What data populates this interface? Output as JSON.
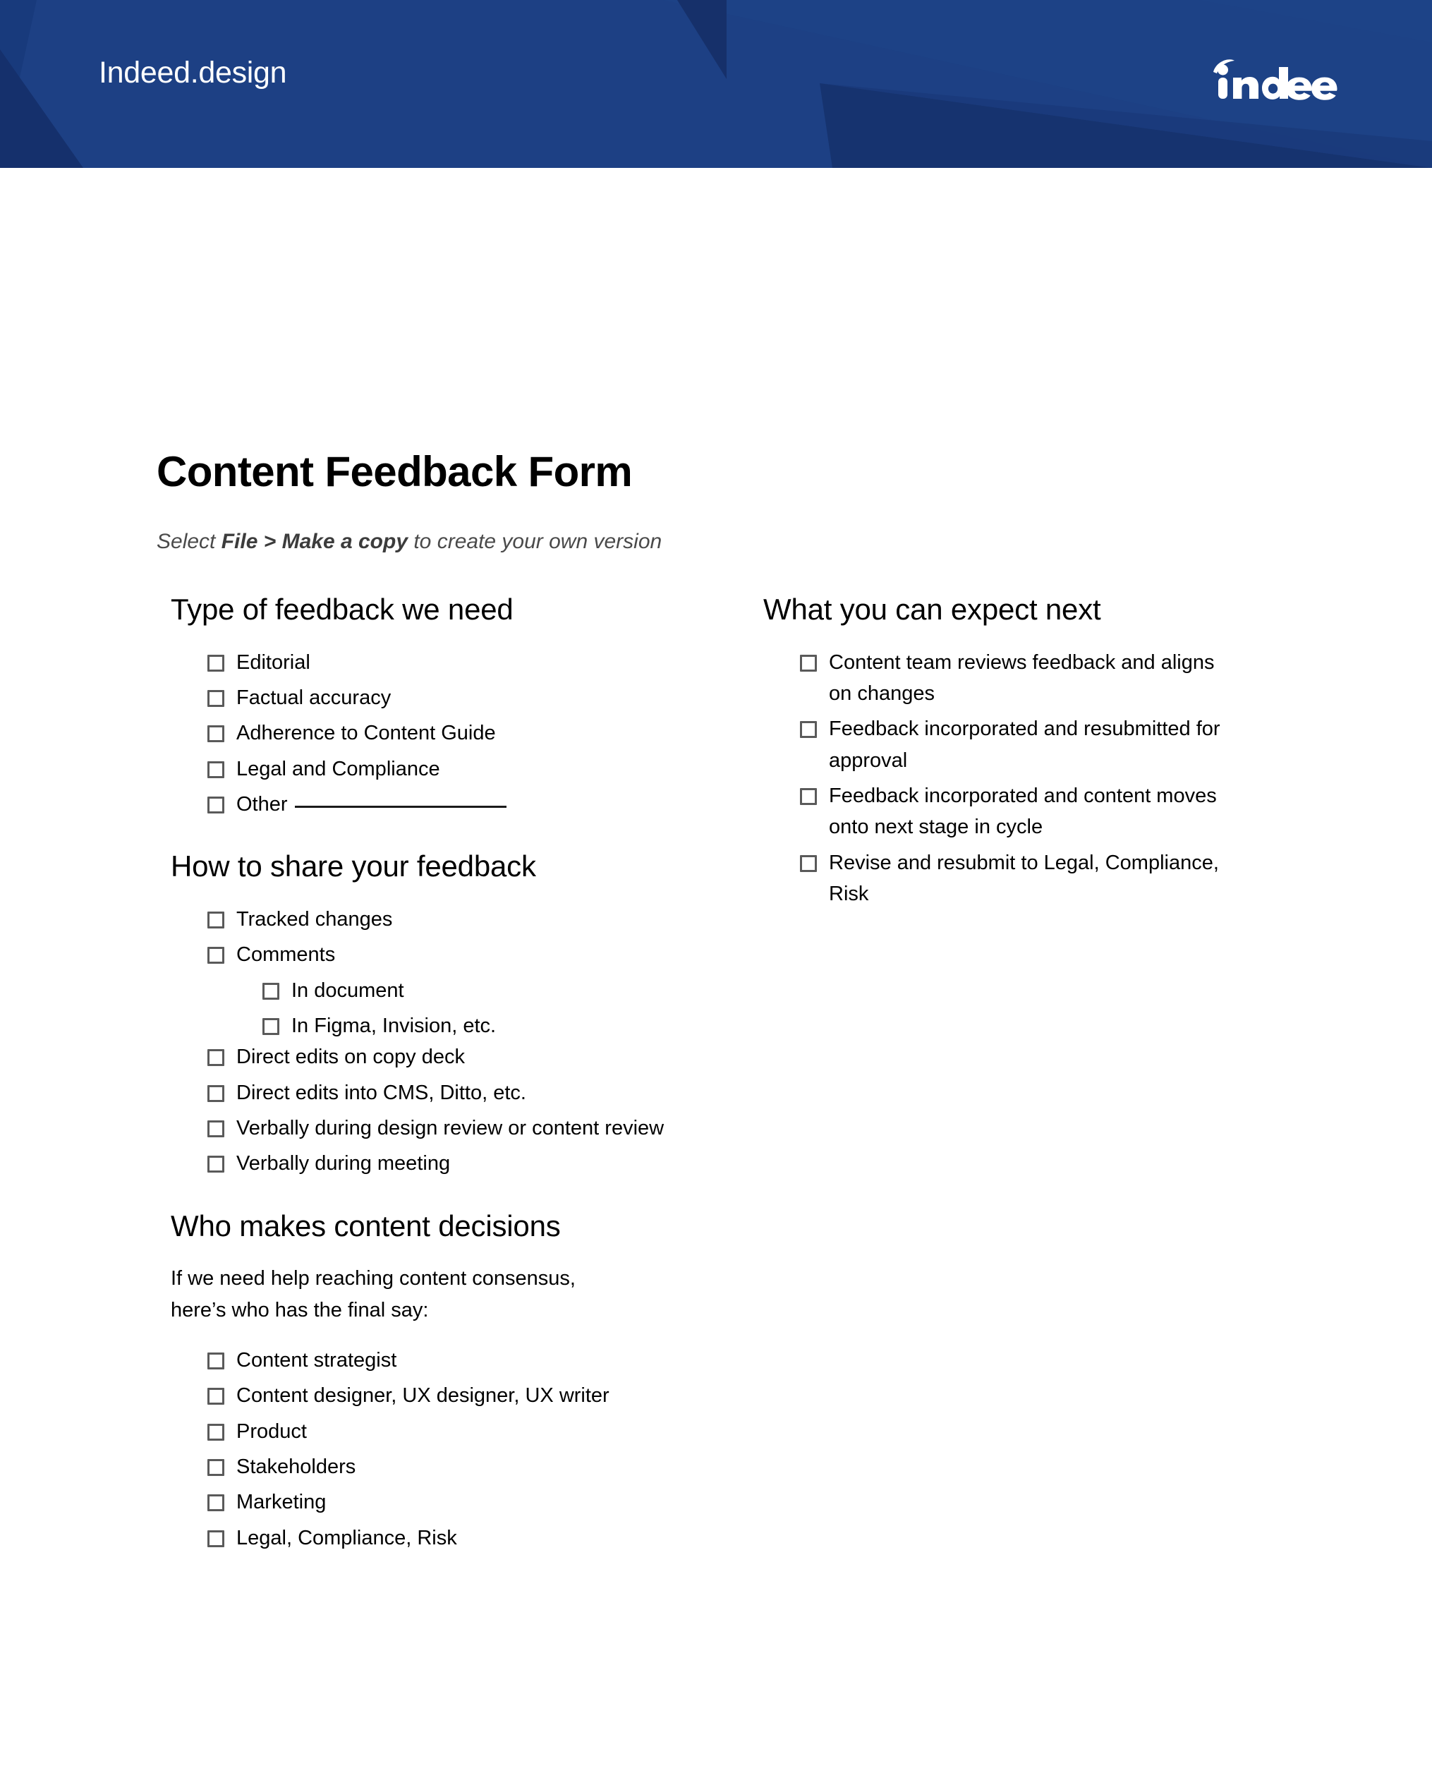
{
  "banner": {
    "brand_wordmark": "Indeed.design",
    "logo_name": "indeed",
    "background_color": "#1d4084",
    "accent_dark_color": "#16306a",
    "accent_mid_color": "#1b3a79"
  },
  "document": {
    "title": "Content Feedback Form",
    "subtitle_prefix": "Select ",
    "subtitle_strong": "File > Make a copy",
    "subtitle_suffix": " to create your own version"
  },
  "left_column": {
    "sections": [
      {
        "heading": "Type of feedback we need",
        "items": [
          {
            "label": "Editorial",
            "blank": false
          },
          {
            "label": "Factual accuracy",
            "blank": false
          },
          {
            "label": "Adherence to Content Guide",
            "blank": false
          },
          {
            "label": "Legal and Compliance",
            "blank": false
          },
          {
            "label": "Other",
            "blank": true
          }
        ]
      },
      {
        "heading": "How to share your feedback",
        "items": [
          {
            "label": "Tracked changes",
            "blank": false
          },
          {
            "label": "Comments",
            "blank": false
          },
          {
            "label": "In document",
            "blank": false,
            "sub": true
          },
          {
            "label": "In Figma, Invision, etc.",
            "blank": false,
            "sub": true
          },
          {
            "label": "Direct edits on copy deck",
            "blank": false
          },
          {
            "label": "Direct edits into CMS, Ditto, etc.",
            "blank": false
          },
          {
            "label": "Verbally during design review or content review",
            "blank": false
          },
          {
            "label": "Verbally during meeting",
            "blank": false
          }
        ]
      },
      {
        "heading": "Who makes content decisions",
        "note": "If we need help reaching content consensus, here’s who has the final say:",
        "items": [
          {
            "label": "Content strategist",
            "blank": false
          },
          {
            "label": "Content designer, UX designer, UX writer",
            "blank": false
          },
          {
            "label": "Product",
            "blank": false
          },
          {
            "label": "Stakeholders",
            "blank": false
          },
          {
            "label": "Marketing",
            "blank": false
          },
          {
            "label": "Legal, Compliance, Risk",
            "blank": false
          }
        ]
      }
    ]
  },
  "right_column": {
    "sections": [
      {
        "heading": "What you can expect next",
        "items": [
          {
            "label": "Content team reviews feedback and aligns on changes",
            "blank": false
          },
          {
            "label": "Feedback incorporated and resubmitted for approval",
            "blank": false
          },
          {
            "label": "Feedback incorporated and content moves onto next stage in cycle",
            "blank": false
          },
          {
            "label": "Revise and resubmit to Legal, Compliance, Risk",
            "blank": false
          }
        ]
      }
    ]
  }
}
